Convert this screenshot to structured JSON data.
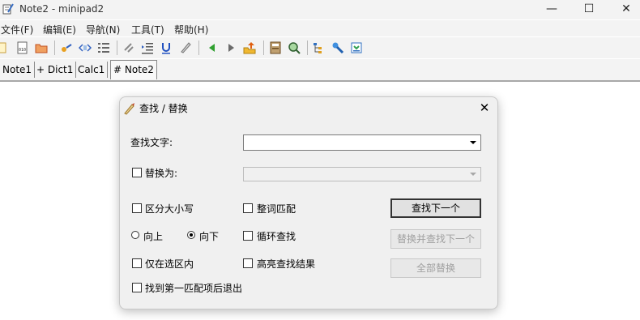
{
  "window": {
    "title": "Note2 - minipad2",
    "minimize_glyph": "—",
    "maximize_glyph": "☐",
    "close_glyph": "✕"
  },
  "menu": {
    "items": [
      "文件(F)",
      "编辑(E)",
      "导航(N)",
      "工具(T)",
      "帮助(H)"
    ]
  },
  "tabs": {
    "items": [
      "Note1",
      "+ Dict1",
      "Calc1",
      "# Note2"
    ],
    "active": "# Note2"
  },
  "dialog": {
    "title": "查找 / 替换",
    "close_glyph": "✕",
    "find_label": "查找文字:",
    "find_value": "",
    "replace_label": "替换为:",
    "replace_checked": false,
    "replace_value": "",
    "options": {
      "case_sensitive": {
        "label": "区分大小写",
        "checked": false
      },
      "whole_word": {
        "label": "整词匹配",
        "checked": false
      },
      "loop_search": {
        "label": "循环查找",
        "checked": false
      },
      "in_selection": {
        "label": "仅在选区内",
        "checked": false
      },
      "highlight_results": {
        "label": "高亮查找结果",
        "checked": false
      },
      "exit_after_first": {
        "label": "找到第一匹配项后退出",
        "checked": false
      }
    },
    "direction": {
      "up_label": "向上",
      "down_label": "向下",
      "selected": "down"
    },
    "buttons": {
      "find_next": "查找下一个",
      "replace_find_next": "替换并查找下一个",
      "replace_all": "全部替换"
    }
  },
  "colors": {
    "chrome": "#f3f3f3",
    "dialog_bg": "#f0f0f0",
    "disabled_text": "#a0a0a0"
  }
}
